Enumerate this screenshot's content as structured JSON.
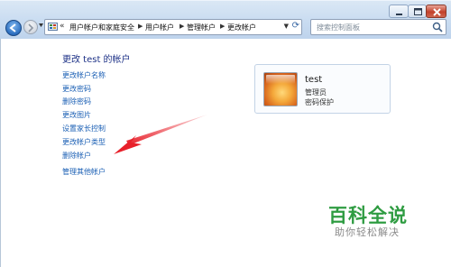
{
  "window": {
    "address_back": "«",
    "breadcrumbs": [
      "用户帐户和家庭安全",
      "用户帐户",
      "管理帐户",
      "更改帐户"
    ],
    "search_placeholder": "搜索控制面板"
  },
  "page": {
    "title": "更改 test 的帐户",
    "tasks": [
      "更改帐户名称",
      "更改密码",
      "删除密码",
      "更改图片",
      "设置家长控制",
      "更改帐户类型",
      "删除帐户"
    ],
    "other_link": "管理其他帐户"
  },
  "account": {
    "name": "test",
    "role": "管理员",
    "status": "密码保护"
  },
  "annotation": {
    "arrow_color": "#e8202a"
  },
  "watermark": {
    "title": "百科全说",
    "subtitle": "助你轻松解决"
  },
  "colors": {
    "link": "#1a5fb4",
    "title": "#1e3287",
    "accent_arrow": "#e8202a",
    "watermark_green": "#2f9c42"
  },
  "icons": [
    "back-icon",
    "forward-icon",
    "control-panel-icon",
    "refresh-icon",
    "search-icon",
    "minimize-icon",
    "maximize-icon",
    "close-icon",
    "user-avatar"
  ]
}
